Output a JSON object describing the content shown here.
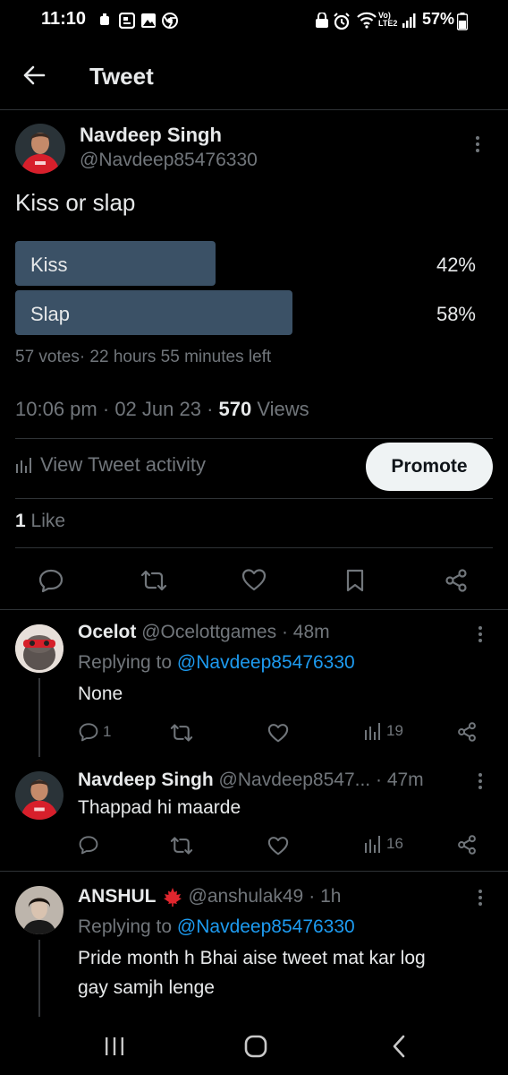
{
  "status_bar": {
    "time": "11:10",
    "battery": "57%",
    "signal_label": "Vo) LTE2"
  },
  "header": {
    "title": "Tweet"
  },
  "tweet": {
    "author_name": "Navdeep Singh",
    "author_handle": "@Navdeep85476330",
    "text": "Kiss or slap",
    "poll": {
      "options": [
        {
          "label": "Kiss",
          "percent_text": "42%",
          "percent": 42
        },
        {
          "label": "Slap",
          "percent_text": "58%",
          "percent": 58
        }
      ],
      "votes_text": "57 votes· 22 hours 55 minutes left"
    },
    "time": "10:06 pm",
    "date": "02 Jun 23",
    "views_count": "570",
    "views_label": "Views",
    "activity_label": "View Tweet activity",
    "promote_label": "Promote",
    "likes_count": "1",
    "likes_label": "Like"
  },
  "replies": [
    {
      "author_name": "Ocelot",
      "author_handle": "@Ocelottgames",
      "time": "· 48m",
      "replying_prefix": "Replying to",
      "replying_handle": "@Navdeep85476330",
      "text": "None",
      "reply_count": "1",
      "views_count": "19"
    },
    {
      "author_name": "Navdeep Singh",
      "author_handle": "@Navdeep8547...",
      "time": "· 47m",
      "text": "Thappad hi maarde",
      "views_count": "16"
    },
    {
      "author_name": "ANSHUL",
      "author_handle": "@anshulak49",
      "time": "· 1h",
      "replying_prefix": "Replying to",
      "replying_handle": "@Navdeep85476330",
      "text_line1": "Pride month h Bhai aise tweet mat kar log",
      "text_line2": "gay samjh lenge"
    }
  ],
  "colors": {
    "background": "#000000",
    "poll_bar": "#3b5166",
    "link": "#1d9bf0",
    "secondary_text": "#71767b"
  }
}
